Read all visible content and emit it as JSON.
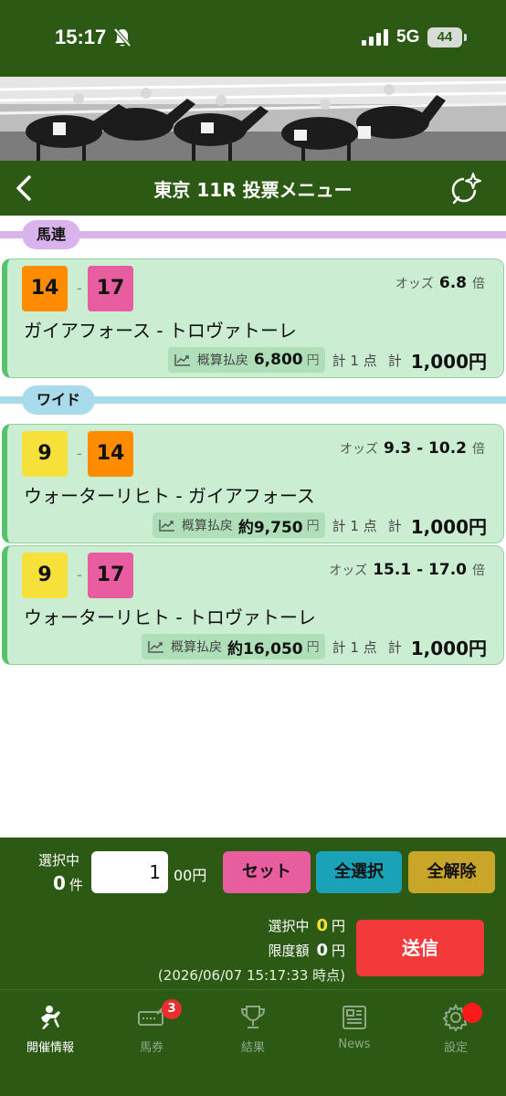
{
  "status_bar": {
    "time": "15:17",
    "network": "5G",
    "battery": "44"
  },
  "nav": {
    "title": "東京 11R 投票メニュー"
  },
  "sections": [
    {
      "label": "馬連",
      "color": "#d9b3ec"
    },
    {
      "label": "ワイド",
      "color": "#a8dcec"
    }
  ],
  "bets": [
    {
      "num1": "14",
      "num1_color": "#ff8c00",
      "num2": "17",
      "num2_color": "#e85ca0",
      "dash": "-",
      "odds_label": "オッズ",
      "odds": "6.8",
      "odds_unit": "倍",
      "horses": "ガイアフォース - トロヴァトーレ",
      "payout_label": "概算払戻",
      "payout": "6,800",
      "payout_unit": "円",
      "points": "計 1 点",
      "total_label": "計",
      "total": "1,000円"
    },
    {
      "num1": "9",
      "num1_color": "#f7e03a",
      "num2": "14",
      "num2_color": "#ff8c00",
      "dash": "-",
      "odds_label": "オッズ",
      "odds": "9.3 - 10.2",
      "odds_unit": "倍",
      "horses": "ウォーターリヒト - ガイアフォース",
      "payout_label": "概算払戻",
      "payout": "約9,750",
      "payout_unit": "円",
      "points": "計 1 点",
      "total_label": "計",
      "total": "1,000円"
    },
    {
      "num1": "9",
      "num1_color": "#f7e03a",
      "num2": "17",
      "num2_color": "#e85ca0",
      "dash": "-",
      "odds_label": "オッズ",
      "odds": "15.1 - 17.0",
      "odds_unit": "倍",
      "horses": "ウォーターリヒト - トロヴァトーレ",
      "payout_label": "概算払戻",
      "payout": "約16,050",
      "payout_unit": "円",
      "points": "計 1 点",
      "total_label": "計",
      "total": "1,000円"
    }
  ],
  "panel": {
    "selecting_label": "選択中",
    "count_value": "0",
    "count_unit": "件",
    "amount_value": "1",
    "amount_suffix": "00円",
    "set_label": "セット",
    "select_all_label": "全選択",
    "clear_all_label": "全解除",
    "selected_label": "選択中",
    "selected_value": "0",
    "selected_unit": "円",
    "limit_label": "限度額",
    "limit_value": "0",
    "limit_unit": "円",
    "send_label": "送信",
    "timestamp": "(2026/06/07 15:17:33 時点)",
    "colors": {
      "set": "#e85ca0",
      "select_all": "#1aa3b8",
      "clear_all": "#c9a52a",
      "highlight": "#f7e03a"
    }
  },
  "tabs": [
    {
      "label": "開催情報",
      "icon": "jockey-icon",
      "active": true
    },
    {
      "label": "馬券",
      "icon": "ticket-icon",
      "badge": "3"
    },
    {
      "label": "結果",
      "icon": "trophy-icon"
    },
    {
      "label": "News",
      "icon": "newspaper-icon"
    },
    {
      "label": "設定",
      "icon": "gear-icon",
      "dot": true
    }
  ]
}
